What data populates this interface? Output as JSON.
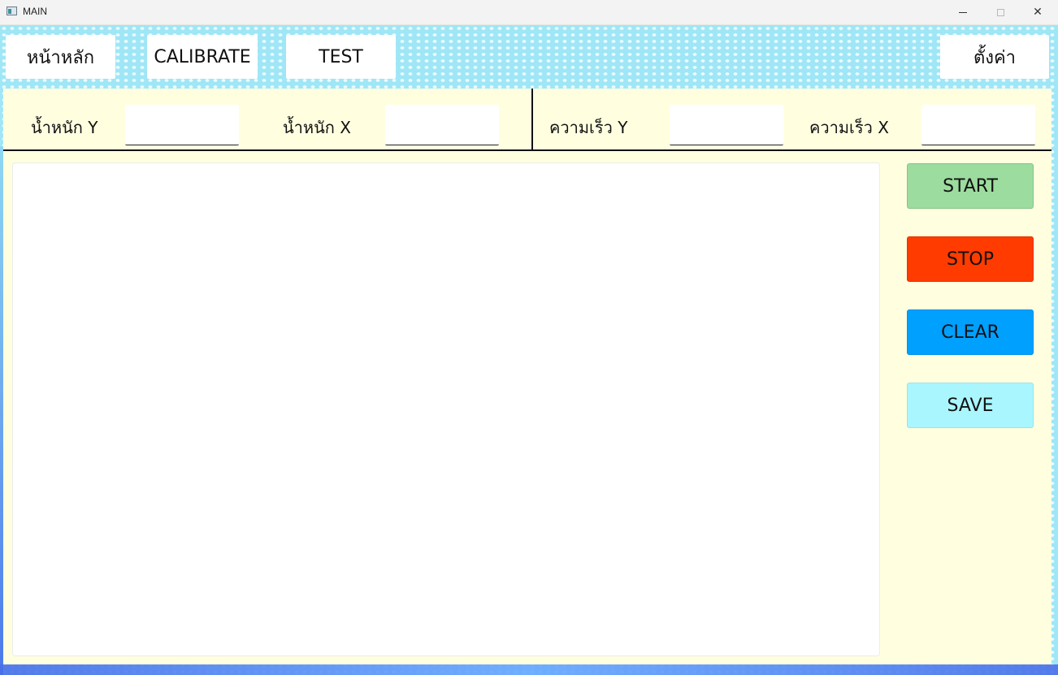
{
  "window": {
    "title": "MAIN",
    "minimize_icon": "minimize-icon",
    "maximize_icon": "maximize-icon",
    "close_icon": "close-icon",
    "close_glyph": "✕"
  },
  "nav": {
    "home_label": "หน้าหลัก",
    "calibrate_label": "CALIBRATE",
    "test_label": "TEST",
    "settings_label": "ตั้งค่า"
  },
  "params": {
    "weight_y_label": "น้ำหนัก Y",
    "weight_y_value": "",
    "weight_x_label": "น้ำหนัก X",
    "weight_x_value": "",
    "speed_y_label": "ความเร็ว Y",
    "speed_y_value": "",
    "speed_x_label": "ความเร็ว X",
    "speed_x_value": ""
  },
  "log": {
    "content": ""
  },
  "actions": {
    "start_label": "START",
    "stop_label": "STOP",
    "clear_label": "CLEAR",
    "save_label": "SAVE"
  },
  "colors": {
    "content_bg": "#ffffe0",
    "start": "#9cdc9e",
    "stop": "#ff3b00",
    "clear": "#00a0ff",
    "save": "#aaf6ff",
    "pattern": "#9fe6f6"
  }
}
